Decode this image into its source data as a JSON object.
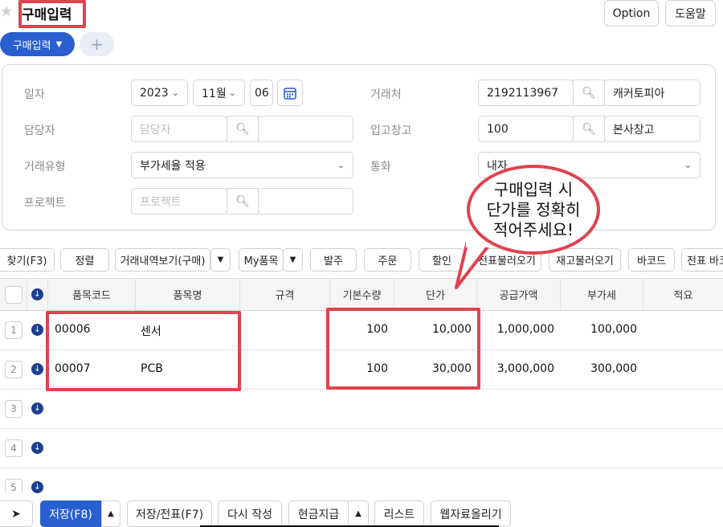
{
  "header": {
    "title": "구매입력",
    "option_label": "Option",
    "help_label": "도움말"
  },
  "tabs": {
    "active": "구매입력",
    "add": "+"
  },
  "form": {
    "date_label": "일자",
    "year": "2023",
    "month": "11월",
    "day": "06",
    "vendor_label": "거래처",
    "vendor_code": "2192113967",
    "vendor_name": "캐커토피아",
    "manager_label": "담당자",
    "manager_placeholder": "담당자",
    "warehouse_label": "입고창고",
    "warehouse_code": "100",
    "warehouse_name": "본사창고",
    "trade_type_label": "거래유형",
    "trade_type": "부가세율 적용",
    "currency_label": "통화",
    "currency": "내자",
    "project_label": "프로젝트",
    "project_placeholder": "프로젝트"
  },
  "toolbar": {
    "find": "찾기(F3)",
    "sort": "정렬",
    "history": "거래내역보기(구매)",
    "my_items": "My품목",
    "order": "발주",
    "po": "주문",
    "discount": "할인",
    "load_slip": "전표불러오기",
    "load_stock": "재고불러오기",
    "barcode": "바코드",
    "slip_more": "전표 바코"
  },
  "table": {
    "headers": {
      "code": "품목코드",
      "name": "품목명",
      "spec": "규격",
      "qty": "기본수량",
      "price": "단가",
      "supply": "공급가액",
      "vat": "부가세",
      "memo": "적요"
    },
    "rows": [
      {
        "num": "1",
        "code": "00006",
        "name": "센서",
        "qty": "100",
        "price": "10,000",
        "supply": "1,000,000",
        "vat": "100,000"
      },
      {
        "num": "2",
        "code": "00007",
        "name": "PCB",
        "qty": "100",
        "price": "30,000",
        "supply": "3,000,000",
        "vat": "300,000"
      },
      {
        "num": "3"
      },
      {
        "num": "4"
      },
      {
        "num": "5"
      }
    ]
  },
  "bottom": {
    "save": "저장(F8)",
    "save_slip": "저장/전표(F7)",
    "rewrite": "다시 작성",
    "cash": "현금지급",
    "list": "리스트",
    "web_upload": "웹자료올리기"
  },
  "callout": {
    "line1": "구매입력 시",
    "line2": "단가를 정확히",
    "line3": "적어주세요!"
  },
  "colors": {
    "accent": "#2a5fd0",
    "highlight": "#e0424f",
    "nav_icon": "#1c3f8f"
  }
}
